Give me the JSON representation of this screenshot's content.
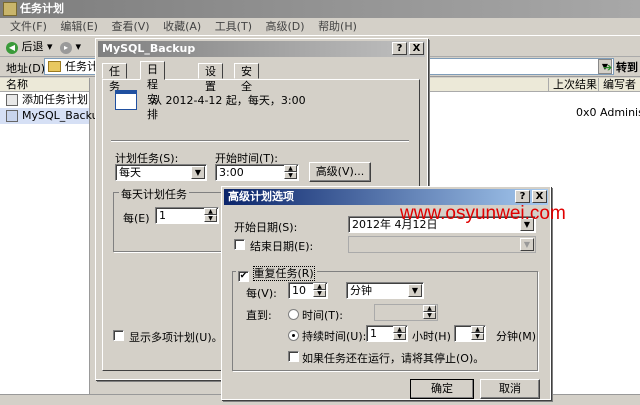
{
  "main": {
    "title": "任务计划",
    "menu": [
      "文件(F)",
      "编辑(E)",
      "查看(V)",
      "收藏(A)",
      "工具(T)",
      "高级(D)",
      "帮助(H)"
    ],
    "toolbar": {
      "back": "后退",
      "forward": "▸"
    },
    "address_label": "地址(D)",
    "address_value": "任务计",
    "go_label": "转到",
    "list_header": "名称",
    "list_items": [
      "添加任务计划",
      "MySQL_Backup"
    ],
    "right_headers": [
      "上次结果",
      "编写者"
    ],
    "right_row": [
      "0x0",
      "Administ"
    ]
  },
  "dialog1": {
    "title": "MySQL_Backup",
    "help_btn": "?",
    "close_btn": "X",
    "tabs": [
      "任务",
      "日程安排",
      "设置",
      "安全"
    ],
    "schedule_summary": "从 2012-4-12 起，每天，3:00",
    "schedule_label": "计划任务(S):",
    "schedule_value": "每天",
    "start_time_label": "开始时间(T):",
    "start_time_value": "3:00",
    "advanced_button": "高级(V)...",
    "daily_group": "每天计划任务",
    "every_label": "每(E)",
    "every_value": "1",
    "show_multiple_label": "显示多项计划(U)。"
  },
  "dialog2": {
    "title": "高级计划选项",
    "help_btn": "?",
    "close_btn": "X",
    "start_date_label": "开始日期(S):",
    "start_date_value": "2012年 4月12日",
    "end_date_label": "结束日期(E):",
    "repeat_label": "重复任务(R)",
    "repeat_checked": true,
    "every_label": "每(V):",
    "every_value": "10",
    "unit_value": "分钟",
    "until_label": "直到:",
    "time_label": "时间(T):",
    "duration_label": "持续时间(U):",
    "duration_hours": "1",
    "hours_label": "小时(H)",
    "minutes_label": "分钟(M)",
    "stop_label": "如果任务还在运行，请将其停止(O)。",
    "ok_button": "确定",
    "cancel_button": "取消"
  },
  "watermark": "www.osyunwei.com"
}
